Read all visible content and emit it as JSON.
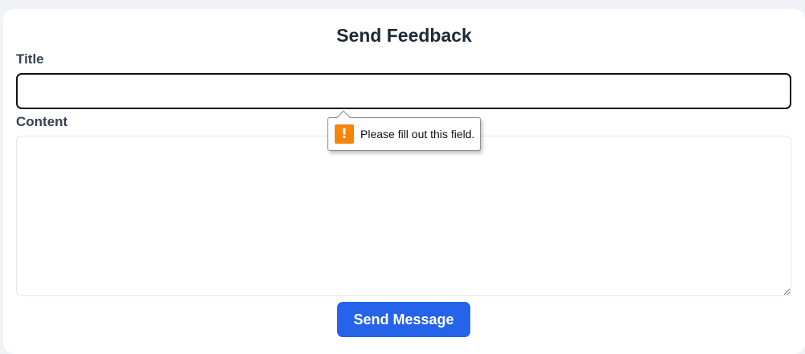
{
  "form": {
    "heading": "Send Feedback",
    "title_label": "Title",
    "title_value": "",
    "content_label": "Content",
    "content_value": "",
    "submit_label": "Send Message"
  },
  "validation_tooltip": {
    "icon": "warning-icon",
    "icon_glyph": "!",
    "message": "Please fill out this field."
  },
  "colors": {
    "accent": "#2563eb",
    "warning": "#f5850b",
    "heading_text": "#1f2937",
    "background": "#f0f2f5"
  }
}
